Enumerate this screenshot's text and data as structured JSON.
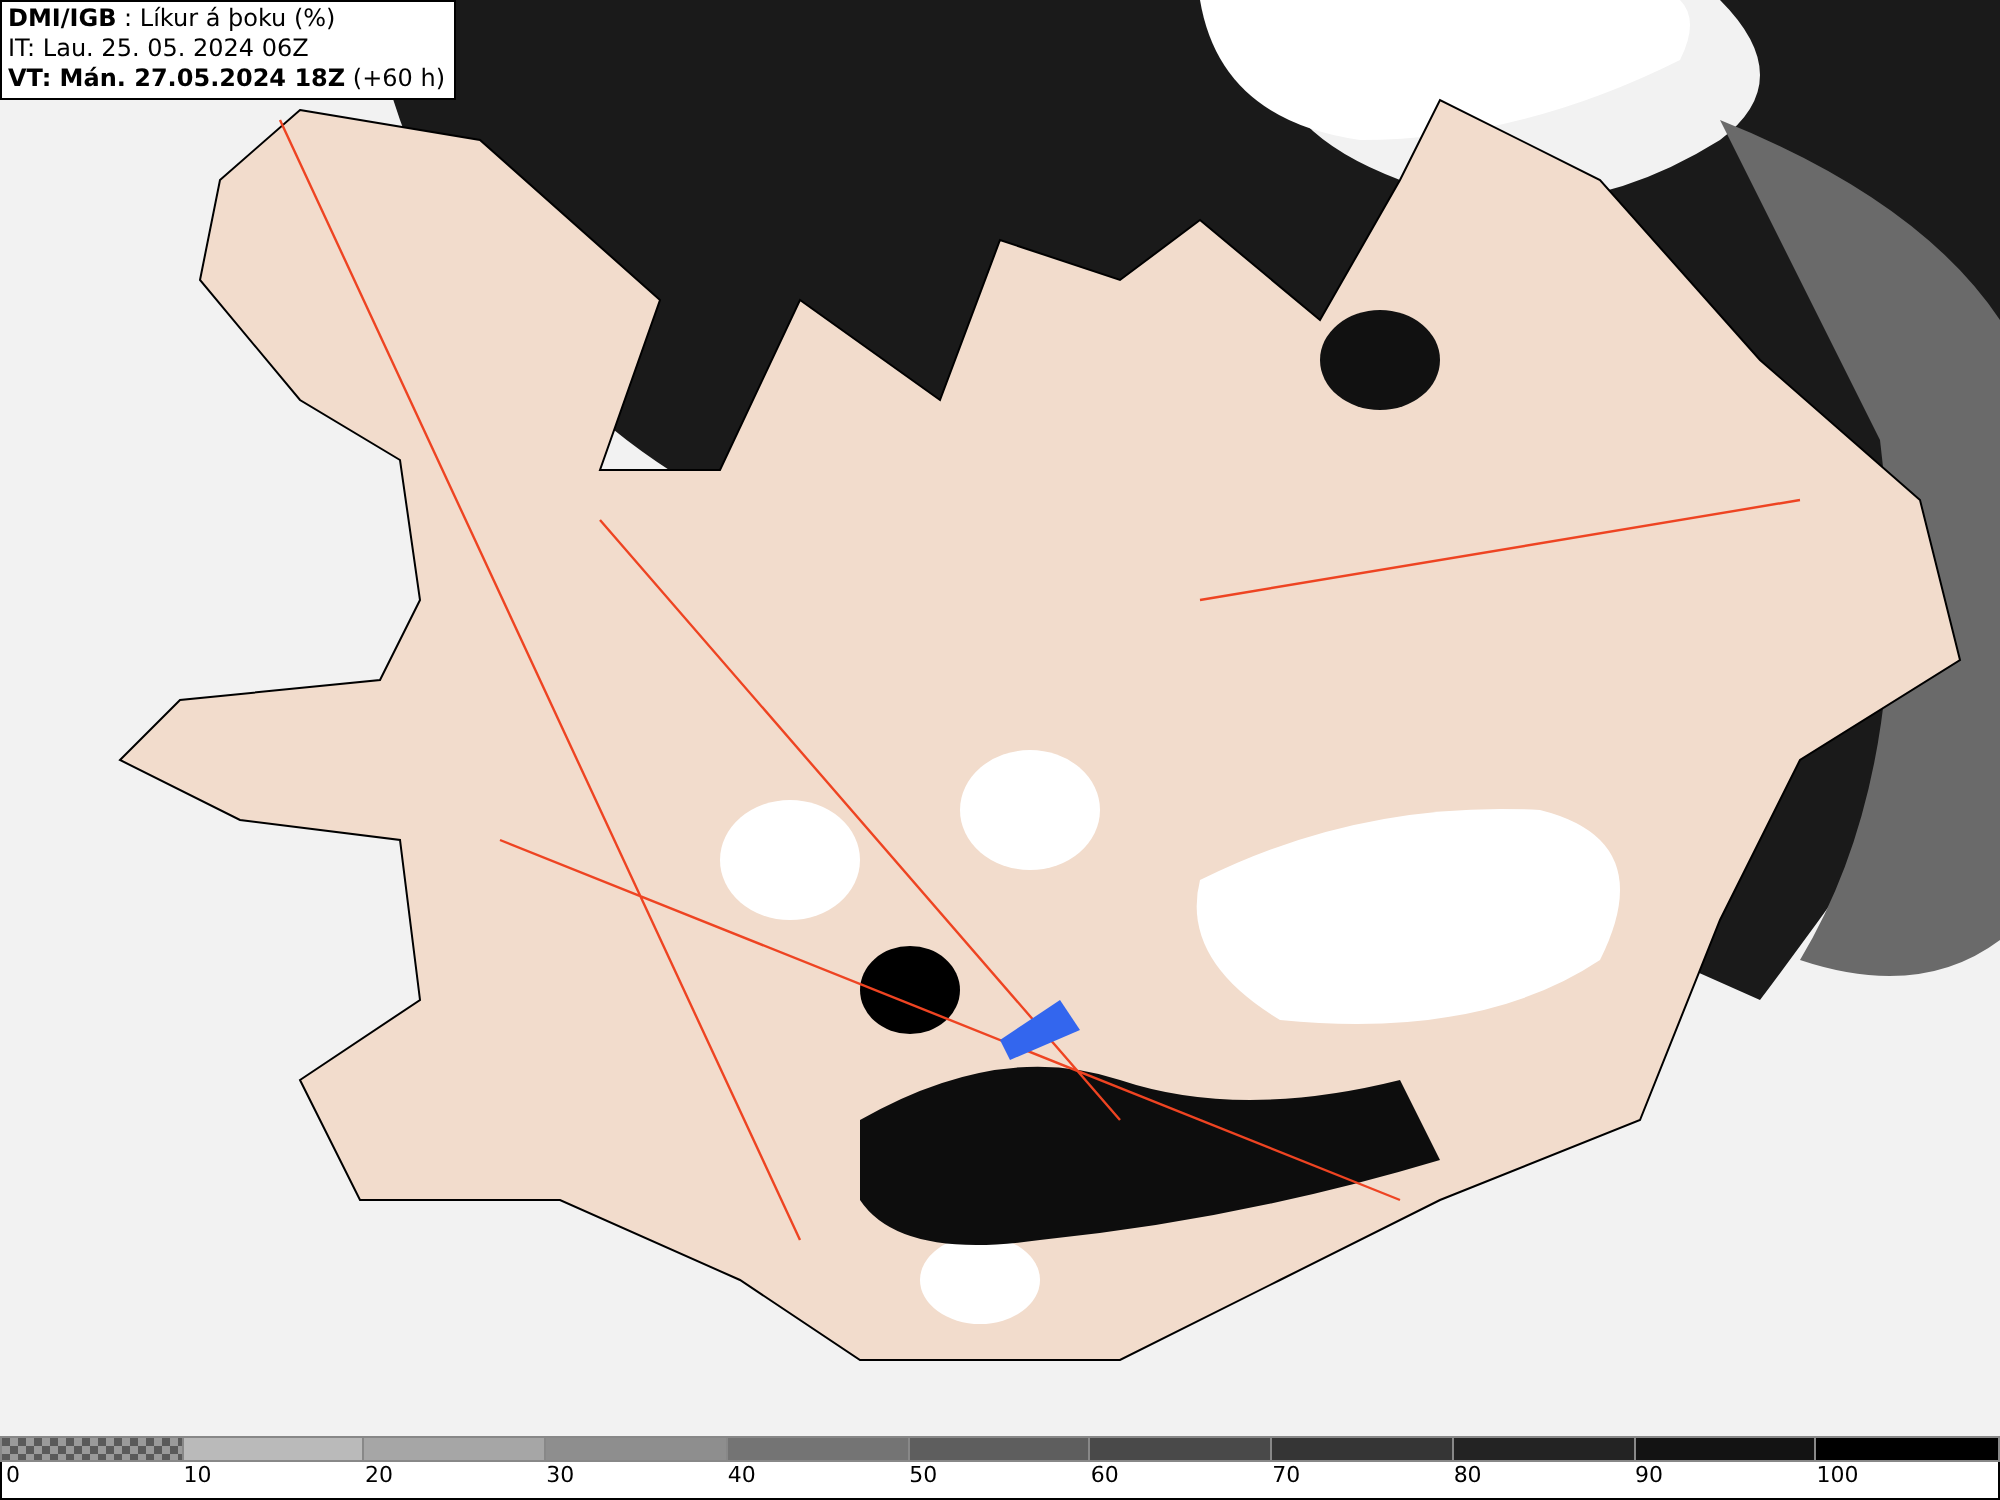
{
  "header": {
    "title": "**DMI/IGB** : Líkur á þoku (%)",
    "issue_time": "IT: Lau. 25. 05. 2024 06Z",
    "valid_time": "**VT: Mán. 27.05.2024 18Z** (+60 h)"
  },
  "legend": [
    {
      "label": "0",
      "kind": "checker",
      "color": "#9a9a9a"
    },
    {
      "label": "10",
      "kind": "solid",
      "color": "#bababa"
    },
    {
      "label": "20",
      "kind": "solid",
      "color": "#a6a6a6"
    },
    {
      "label": "30",
      "kind": "solid",
      "color": "#8e8e8e"
    },
    {
      "label": "40",
      "kind": "solid",
      "color": "#747474"
    },
    {
      "label": "50",
      "kind": "solid",
      "color": "#5e5e5e"
    },
    {
      "label": "60",
      "kind": "solid",
      "color": "#494949"
    },
    {
      "label": "70",
      "kind": "solid",
      "color": "#353535"
    },
    {
      "label": "80",
      "kind": "solid",
      "color": "#232323"
    },
    {
      "label": "90",
      "kind": "solid",
      "color": "#131313"
    },
    {
      "label": "100",
      "kind": "solid",
      "color": "#000000"
    }
  ]
}
